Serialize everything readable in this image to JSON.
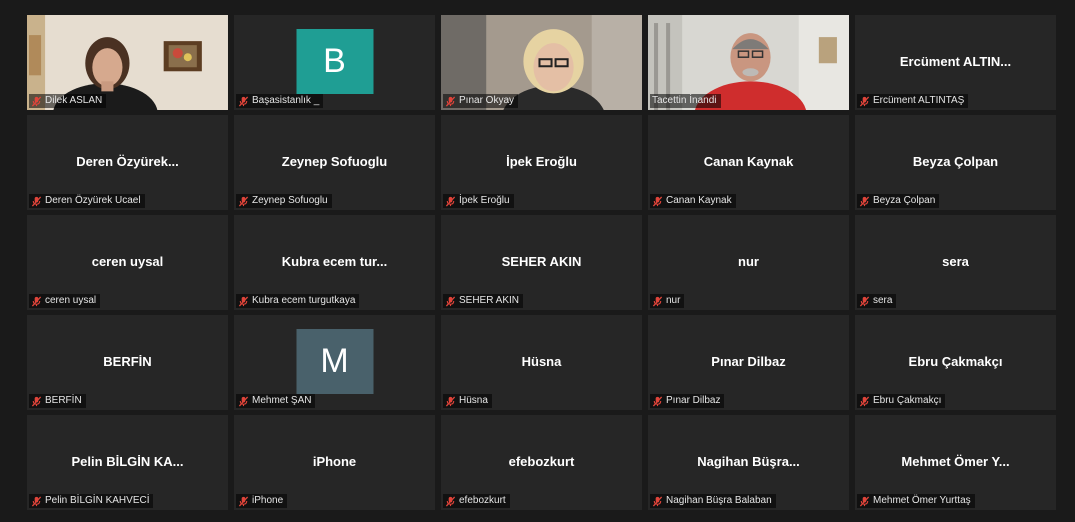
{
  "colors": {
    "active_speaker_border": "#c9e84a",
    "mute_icon": "#e0443a",
    "avatar_b": "#1f9e94",
    "avatar_m": "#49616b"
  },
  "participants": [
    {
      "display": "",
      "label": "Dilek ASLAN",
      "muted": true,
      "media": "video-1"
    },
    {
      "display": "B",
      "label": "Başasistanlık _",
      "muted": true,
      "media": "avatar-b"
    },
    {
      "display": "",
      "label": "Pınar Okyay",
      "muted": true,
      "media": "video-3"
    },
    {
      "display": "",
      "label": "Tacettin İnandi",
      "muted": false,
      "media": "video-4",
      "speaking": true
    },
    {
      "display": "Ercüment ALTIN...",
      "label": "Ercüment ALTINTAŞ",
      "muted": true
    },
    {
      "display": "Deren Özyürek...",
      "label": "Deren Özyürek Ucael",
      "muted": true
    },
    {
      "display": "Zeynep Sofuoglu",
      "label": "Zeynep Sofuoglu",
      "muted": true
    },
    {
      "display": "İpek Eroğlu",
      "label": "İpek Eroğlu",
      "muted": true
    },
    {
      "display": "Canan Kaynak",
      "label": "Canan Kaynak",
      "muted": true
    },
    {
      "display": "Beyza Çolpan",
      "label": "Beyza Çolpan",
      "muted": true
    },
    {
      "display": "ceren uysal",
      "label": "ceren uysal",
      "muted": true
    },
    {
      "display": "Kubra ecem tur...",
      "label": "Kubra ecem turgutkaya",
      "muted": true
    },
    {
      "display": "SEHER AKIN",
      "label": "SEHER AKIN",
      "muted": true
    },
    {
      "display": "nur",
      "label": "nur",
      "muted": true
    },
    {
      "display": "sera",
      "label": "sera",
      "muted": true
    },
    {
      "display": "BERFİN",
      "label": "BERFİN",
      "muted": true
    },
    {
      "display": "M",
      "label": "Mehmet ŞAN",
      "muted": true,
      "media": "avatar-m"
    },
    {
      "display": "Hüsna",
      "label": "Hüsna",
      "muted": true
    },
    {
      "display": "Pınar Dilbaz",
      "label": "Pınar Dilbaz",
      "muted": true
    },
    {
      "display": "Ebru Çakmakçı",
      "label": "Ebru Çakmakçı",
      "muted": true
    },
    {
      "display": "Pelin BİLGİN KA...",
      "label": "Pelin BİLGİN KAHVECİ",
      "muted": true
    },
    {
      "display": "iPhone",
      "label": "iPhone",
      "muted": true
    },
    {
      "display": "efebozkurt",
      "label": "efebozkurt",
      "muted": true
    },
    {
      "display": "Nagihan Büşra...",
      "label": "Nagihan Büşra Balaban",
      "muted": true
    },
    {
      "display": "Mehmet Ömer Y...",
      "label": "Mehmet Ömer Yurttaş",
      "muted": true
    }
  ]
}
